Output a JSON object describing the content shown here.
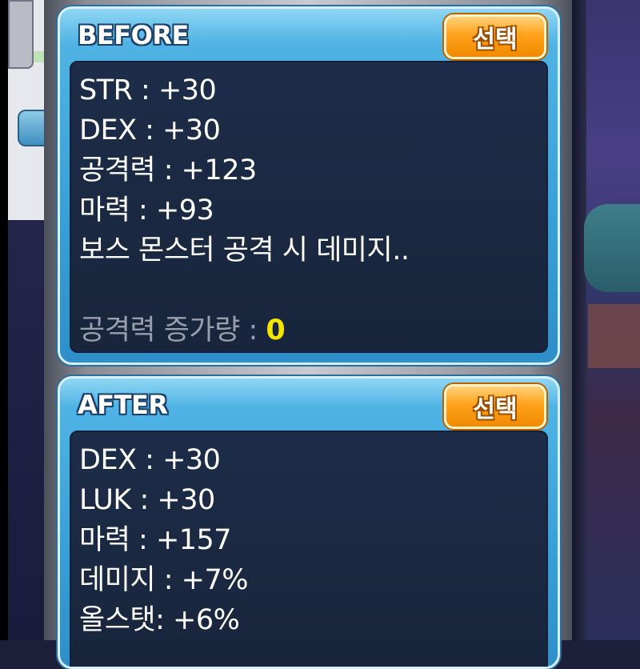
{
  "before": {
    "title": "BEFORE",
    "select_label": "선택",
    "stats": [
      "STR : +30",
      "DEX : +30",
      "공격력 : +123",
      "마력 : +93",
      "보스 몬스터 공격 시 데미지.."
    ],
    "summary_label": "공격력 증가량 : ",
    "summary_value": "0"
  },
  "after": {
    "title": "AFTER",
    "select_label": "선택",
    "stats": [
      "DEX : +30",
      "LUK : +30",
      "마력 : +157",
      "데미지 : +7%",
      "올스탯: +6%"
    ]
  },
  "colors": {
    "panel_blue": "#37a0d8",
    "stat_bg": "#1c2a44",
    "button_orange": "#ffa21c",
    "highlight_yellow": "#f4e600",
    "summary_grey": "#9a9fae"
  }
}
